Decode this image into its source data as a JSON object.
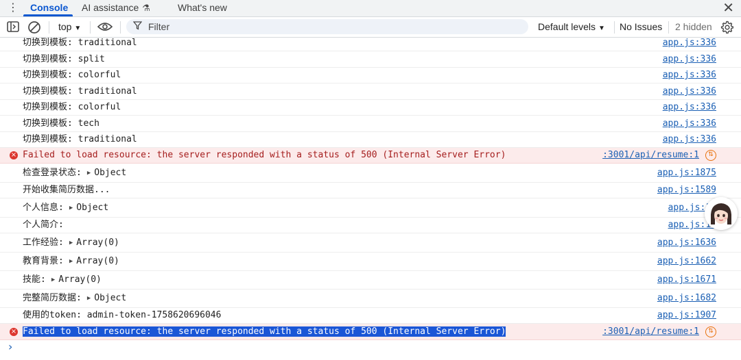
{
  "tabs": {
    "console": "Console",
    "ai_assistance": "AI assistance",
    "whats_new": "What's new"
  },
  "toolbar": {
    "context": "top",
    "filter_placeholder": "Filter",
    "levels": "Default levels",
    "issues": "No Issues",
    "hidden": "2 hidden"
  },
  "logs": [
    {
      "type": "log",
      "label": "切换到模板:",
      "value": "traditional",
      "source": "app.js:336"
    },
    {
      "type": "log",
      "label": "切换到模板:",
      "value": "split",
      "source": "app.js:336"
    },
    {
      "type": "log",
      "label": "切换到模板:",
      "value": "colorful",
      "source": "app.js:336"
    },
    {
      "type": "log",
      "label": "切换到模板:",
      "value": "traditional",
      "source": "app.js:336"
    },
    {
      "type": "log",
      "label": "切换到模板:",
      "value": "colorful",
      "source": "app.js:336"
    },
    {
      "type": "log",
      "label": "切换到模板:",
      "value": "tech",
      "source": "app.js:336"
    },
    {
      "type": "log",
      "label": "切换到模板:",
      "value": "traditional",
      "source": "app.js:336"
    },
    {
      "type": "error",
      "label": "Failed to load resource: the server responded with a status of 500 (Internal Server Error)",
      "value": "",
      "source": ":3001/api/resume:1"
    },
    {
      "type": "log",
      "label": "检查登录状态:",
      "value": "Object",
      "expandable": true,
      "source": "app.js:1875"
    },
    {
      "type": "log",
      "label": "开始收集简历数据...",
      "value": "",
      "source": "app.js:1589"
    },
    {
      "type": "log",
      "label": "个人信息:",
      "value": "Object",
      "expandable": true,
      "source": "app.js:16"
    },
    {
      "type": "log",
      "label": "个人简介:",
      "value": "",
      "source": "app.js:16"
    },
    {
      "type": "log",
      "label": "工作经验:",
      "value": "Array(0)",
      "expandable": true,
      "source": "app.js:1636"
    },
    {
      "type": "log",
      "label": "教育背景:",
      "value": "Array(0)",
      "expandable": true,
      "source": "app.js:1662"
    },
    {
      "type": "log",
      "label": "技能:",
      "value": "Array(0)",
      "expandable": true,
      "source": "app.js:1671"
    },
    {
      "type": "log",
      "label": "完整简历数据:",
      "value": "Object",
      "expandable": true,
      "source": "app.js:1682"
    },
    {
      "type": "log",
      "label": "使用的token:",
      "value": "admin-token-1758620696046",
      "source": "app.js:1907"
    },
    {
      "type": "error",
      "label": "Failed to load resource: the server responded with a status of 500 (Internal Server Error)",
      "value": "",
      "source": ":3001/api/resume:1",
      "selected": true
    }
  ],
  "prompt_symbol": "›",
  "icons": {
    "menu": "vertical-dots-icon",
    "flask": "flask-icon",
    "close": "close-icon",
    "sidebar": "sidebar-toggle-icon",
    "clear": "clear-console-icon",
    "eye": "eye-icon",
    "filter": "filter-icon",
    "gear": "gear-icon",
    "error": "error-icon",
    "retry": "network-retry-icon",
    "avatar": "assistant-avatar-icon"
  },
  "colors": {
    "accent": "#0b57d0",
    "error_bg": "#fcebeb",
    "error_text": "#a51d1d",
    "link": "#1a5fb4",
    "selection": "#1a56d6"
  }
}
